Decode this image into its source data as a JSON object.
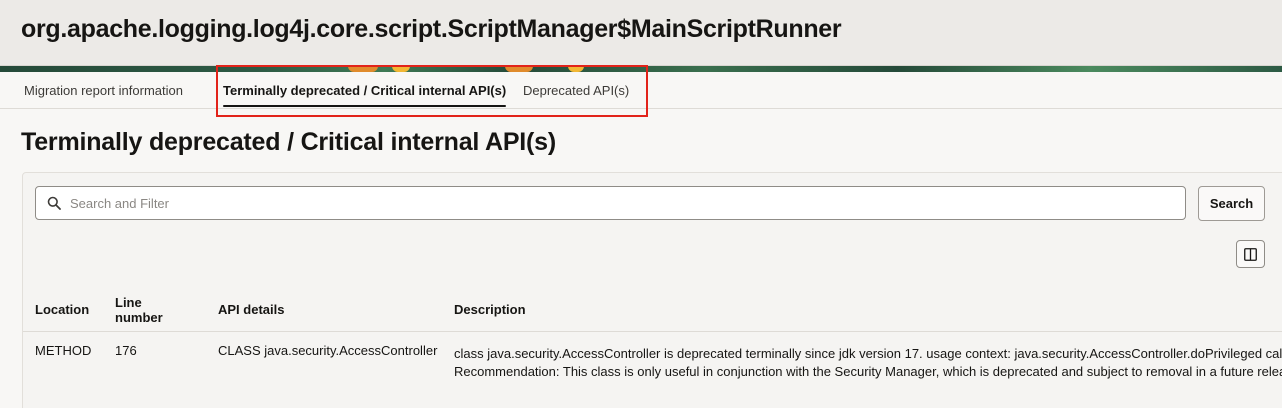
{
  "header": {
    "title": "org.apache.logging.log4j.core.script.ScriptManager$MainScriptRunner"
  },
  "tabs": [
    {
      "label": "Migration report information",
      "active": false
    },
    {
      "label": "Terminally deprecated / Critical internal API(s)",
      "active": true
    },
    {
      "label": "Deprecated API(s)",
      "active": false
    }
  ],
  "page_title": "Terminally deprecated / Critical internal API(s)",
  "search": {
    "placeholder": "Search and Filter",
    "value": "",
    "button_label": "Search"
  },
  "table": {
    "columns": [
      "Location",
      "Line number",
      "API details",
      "Description"
    ],
    "rows": [
      {
        "location": "METHOD",
        "line_number": "176",
        "api_details": "CLASS java.security.AccessController",
        "description_line1": "class java.security.AccessController is deprecated terminally since jdk version 17. usage context: java.security.AccessController.doPrivileged call  Suggestion:",
        "description_line2": "Recommendation: This class is only useful in conjunction with the Security Manager, which is deprecated and subject to removal in a future release."
      }
    ]
  },
  "colors": {
    "highlight": "#e2231a",
    "header_bg": "#eceae7",
    "page_bg": "#f8f7f5"
  },
  "icons": {
    "search": "search-icon",
    "columns": "columns-icon"
  }
}
